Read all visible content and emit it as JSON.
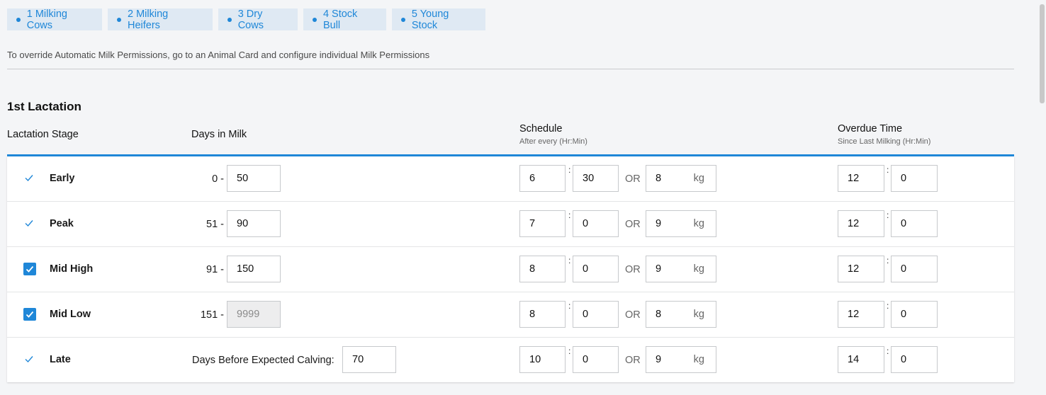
{
  "tabs": [
    {
      "label": "1 Milking Cows"
    },
    {
      "label": "2 Milking Heifers"
    },
    {
      "label": "3 Dry Cows"
    },
    {
      "label": "4 Stock Bull"
    },
    {
      "label": "5 Young Stock"
    }
  ],
  "notice": "To override Automatic Milk Permissions, go to an Animal Card and configure individual Milk Permissions",
  "section_title": "1st Lactation",
  "headers": {
    "stage": "Lactation Stage",
    "dim": "Days in Milk",
    "schedule": "Schedule",
    "schedule_sub": "After every (Hr:Min)",
    "overdue": "Overdue Time",
    "overdue_sub": "Since Last Milking (Hr:Min)"
  },
  "labels": {
    "or": "OR",
    "kg": "kg",
    "colon": ":",
    "dbec": "Days Before Expected Calving:"
  },
  "accent_color": "#1f87d8",
  "rows": [
    {
      "name": "Early",
      "check": "tick",
      "from": "0 -",
      "to": "50",
      "sched_hr": "6",
      "sched_min": "30",
      "kg": "8",
      "over_hr": "12",
      "over_min": "0"
    },
    {
      "name": "Peak",
      "check": "tick",
      "from": "51 -",
      "to": "90",
      "sched_hr": "7",
      "sched_min": "0",
      "kg": "9",
      "over_hr": "12",
      "over_min": "0"
    },
    {
      "name": "Mid High",
      "check": "checkbox",
      "from": "91 -",
      "to": "150",
      "sched_hr": "8",
      "sched_min": "0",
      "kg": "9",
      "over_hr": "12",
      "over_min": "0"
    },
    {
      "name": "Mid Low",
      "check": "checkbox",
      "from": "151 -",
      "to": "9999",
      "to_disabled": true,
      "sched_hr": "8",
      "sched_min": "0",
      "kg": "8",
      "over_hr": "12",
      "over_min": "0"
    },
    {
      "name": "Late",
      "check": "tick",
      "dbec_value": "70",
      "sched_hr": "10",
      "sched_min": "0",
      "kg": "9",
      "over_hr": "14",
      "over_min": "0"
    }
  ]
}
